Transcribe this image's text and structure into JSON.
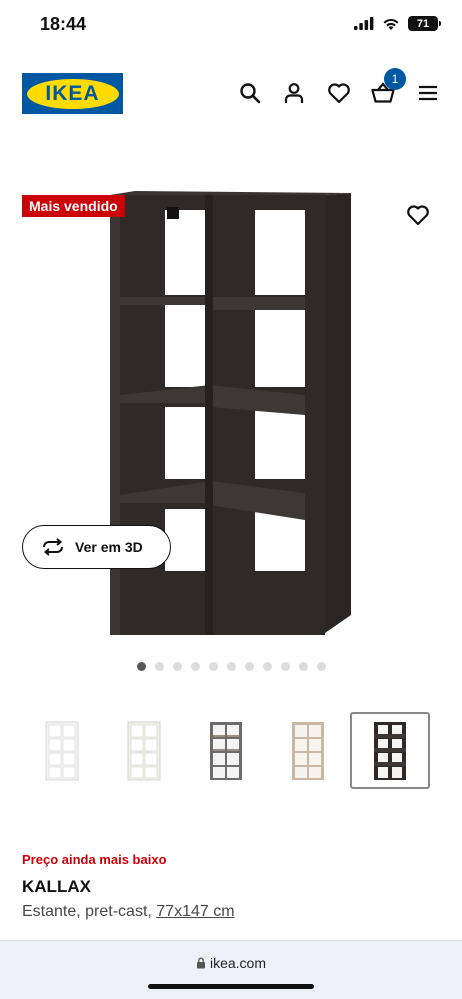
{
  "status_bar": {
    "time": "18:44",
    "battery": "71",
    "icons": [
      "signal-icon",
      "wifi-icon",
      "battery-icon"
    ]
  },
  "header": {
    "logo_text": "IKEA",
    "icons": [
      "search-icon",
      "account-icon",
      "favorites-icon",
      "cart-icon",
      "menu-icon"
    ],
    "cart_count": "1"
  },
  "product": {
    "badge": "Mais vendido",
    "view_3d_label": "Ver em 3D",
    "image_count": 11,
    "active_image_index": 0,
    "variants": [
      {
        "color": "white"
      },
      {
        "color": "white"
      },
      {
        "color": "gray"
      },
      {
        "color": "white-stained oak"
      },
      {
        "color": "black-brown",
        "selected": true
      }
    ],
    "price_note": "Preço ainda mais baixo",
    "name": "KALLAX",
    "description": "Estante, pret-cast, ",
    "size": "77x147 cm"
  },
  "browser": {
    "url": "ikea.com"
  },
  "colors": {
    "brand_blue": "#0058a3",
    "brand_yellow": "#ffdb00",
    "accent_red": "#cc0008"
  }
}
